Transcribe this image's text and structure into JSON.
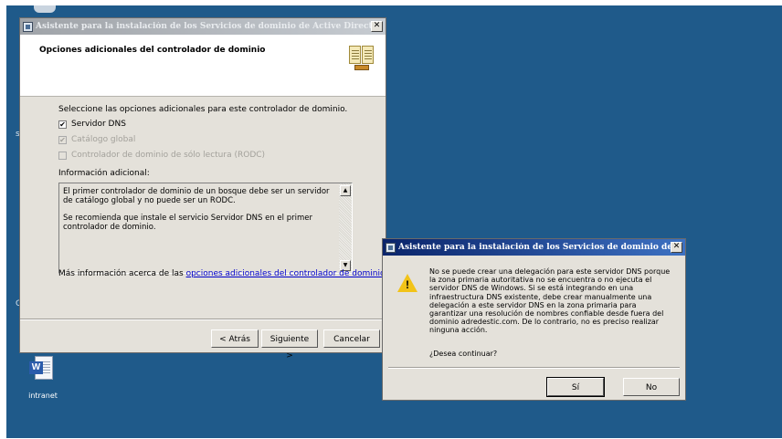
{
  "desktop": {
    "edge_letters": [
      "s",
      "G"
    ],
    "icons": [
      {
        "label": "intranet",
        "icon": "word-document-icon",
        "badge": "W"
      }
    ]
  },
  "main_window": {
    "title": "Asistente para la instalación de los Servicios de dominio de Active Directory",
    "close_glyph": "✕",
    "heading": "Opciones adicionales del controlador de dominio",
    "header_icon": "book-stand-icon",
    "instruction": "Seleccione las opciones adicionales para este controlador de dominio.",
    "options": [
      {
        "label": "Servidor DNS",
        "checked": true,
        "enabled": true,
        "mark": "✔"
      },
      {
        "label": "Catálogo global",
        "checked": true,
        "enabled": false,
        "mark": "✔"
      },
      {
        "label": "Controlador de dominio de sólo lectura (RODC)",
        "checked": false,
        "enabled": false,
        "mark": ""
      }
    ],
    "info_label": "Información adicional:",
    "info_paragraphs": [
      "El primer controlador de dominio de un bosque debe ser un servidor de catálogo global y no puede ser un RODC.",
      "Se recomienda que instale el servicio Servidor DNS en el primer controlador de dominio."
    ],
    "scroll_up_glyph": "▲",
    "scroll_down_glyph": "▼",
    "more_info_prefix": "Más información acerca de las",
    "more_info_link": "opciones adicionales del controlador de dominio",
    "buttons": {
      "back": "< Atrás",
      "next": "Siguiente >",
      "cancel": "Cancelar"
    }
  },
  "dialog": {
    "title": "Asistente para la instalación de los Servicios de dominio de Activ...",
    "close_glyph": "✕",
    "icon": "warning-icon",
    "icon_glyph": "!",
    "message": "No se puede crear una delegación para este servidor DNS porque la zona primaria autoritativa no se encuentra o no ejecuta el servidor DNS de Windows. Si se está integrando en una infraestructura DNS existente, debe crear manualmente una delegación a este servidor DNS en la zona primaria para garantizar una resolución de nombres confiable desde fuera del dominio adredestic.com. De lo contrario, no es preciso realizar ninguna acción.",
    "question": "¿Desea continuar?",
    "buttons": {
      "yes": "Sí",
      "no": "No"
    }
  },
  "colors": {
    "desktop": "#1f5a8a",
    "window_face": "#e4e1da",
    "active_title": "#0a246a",
    "inactive_title": "#9fa3a8",
    "link": "#0000cc",
    "warning": "#f2c318"
  }
}
